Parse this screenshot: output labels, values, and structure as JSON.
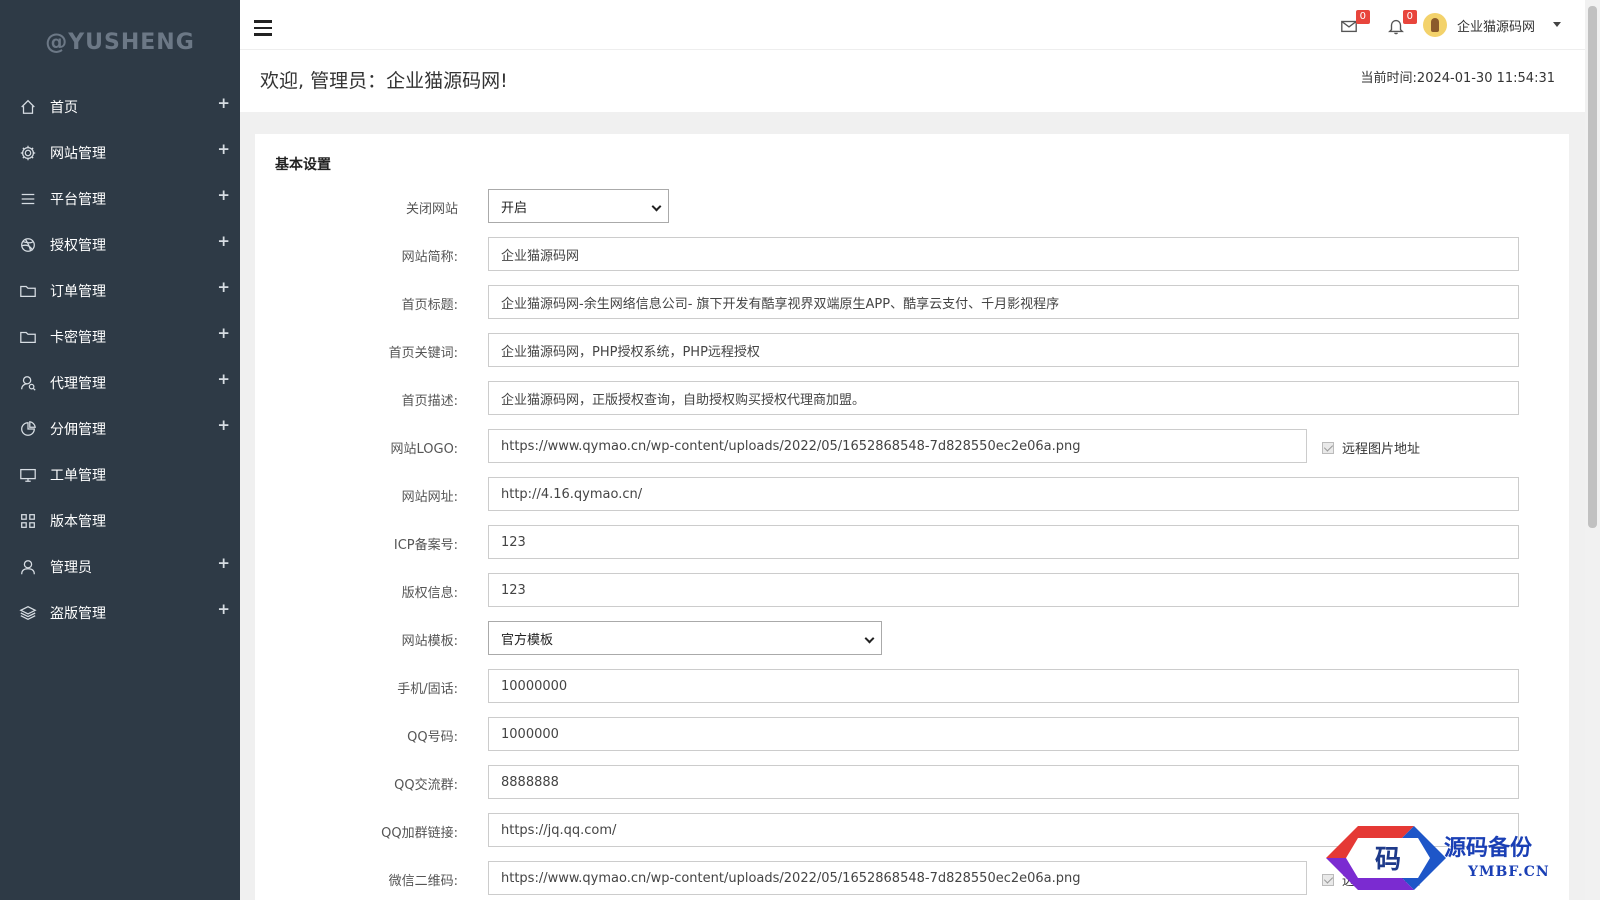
{
  "sidebar": {
    "logo": "@YUSHENG",
    "items": [
      {
        "label": "首页",
        "icon": "home-icon",
        "expandable": true
      },
      {
        "label": "网站管理",
        "icon": "gear-icon",
        "expandable": true
      },
      {
        "label": "平台管理",
        "icon": "list-icon",
        "expandable": true
      },
      {
        "label": "授权管理",
        "icon": "dribbble-icon",
        "expandable": true
      },
      {
        "label": "订单管理",
        "icon": "folder-icon",
        "expandable": true
      },
      {
        "label": "卡密管理",
        "icon": "folder-icon",
        "expandable": true
      },
      {
        "label": "代理管理",
        "icon": "user-search-icon",
        "expandable": true
      },
      {
        "label": "分佣管理",
        "icon": "pie-icon",
        "expandable": true
      },
      {
        "label": "工单管理",
        "icon": "monitor-icon",
        "expandable": false
      },
      {
        "label": "版本管理",
        "icon": "grid-icon",
        "expandable": false
      },
      {
        "label": "管理员",
        "icon": "user-icon",
        "expandable": true
      },
      {
        "label": "盗版管理",
        "icon": "layers-icon",
        "expandable": true
      }
    ],
    "plus_symbol": "+"
  },
  "header": {
    "mail_count": "0",
    "bell_count": "0",
    "user_name": "企业猫源码网"
  },
  "welcome": {
    "text": "欢迎, 管理员：企业猫源码网!",
    "time": "当前时间:2024-01-30 11:54:31"
  },
  "panel": {
    "title": "基本设置",
    "fields": [
      {
        "label": "关闭网站",
        "type": "select",
        "value": "开启"
      },
      {
        "label": "网站简称:",
        "type": "text",
        "value": "企业猫源码网"
      },
      {
        "label": "首页标题:",
        "type": "text",
        "value": "企业猫源码网-余生网络信息公司- 旗下开发有酷享视界双端原生APP、酷享云支付、千月影视程序"
      },
      {
        "label": "首页关键词:",
        "type": "text",
        "value": "企业猫源码网，PHP授权系统，PHP远程授权"
      },
      {
        "label": "首页描述:",
        "type": "text",
        "value": "企业猫源码网，正版授权查询，自助授权购买授权代理商加盟。"
      },
      {
        "label": "网站LOGO:",
        "type": "text-check",
        "value": "https://www.qymao.cn/wp-content/uploads/2022/05/1652868548-7d828550ec2e06a.png",
        "check_label": "远程图片地址"
      },
      {
        "label": "网站网址:",
        "type": "text",
        "value": "http://4.16.qymao.cn/"
      },
      {
        "label": "ICP备案号:",
        "type": "text",
        "value": "123"
      },
      {
        "label": "版权信息:",
        "type": "text",
        "value": "123"
      },
      {
        "label": "网站模板:",
        "type": "select",
        "value": "官方模板"
      },
      {
        "label": "手机/固话:",
        "type": "text",
        "value": "10000000"
      },
      {
        "label": "QQ号码:",
        "type": "text",
        "value": "1000000"
      },
      {
        "label": "QQ交流群:",
        "type": "text",
        "value": "8888888"
      },
      {
        "label": "QQ加群链接:",
        "type": "text",
        "value": "https://jq.qq.com/"
      },
      {
        "label": "微信二维码:",
        "type": "text-check",
        "value": "https://www.qymao.cn/wp-content/uploads/2022/05/1652868548-7d828550ec2e06a.png",
        "check_label": "远程图片地址"
      }
    ]
  },
  "watermark": {
    "text": "源码备份",
    "sub": "YMBF.CN",
    "glyph": "码"
  }
}
